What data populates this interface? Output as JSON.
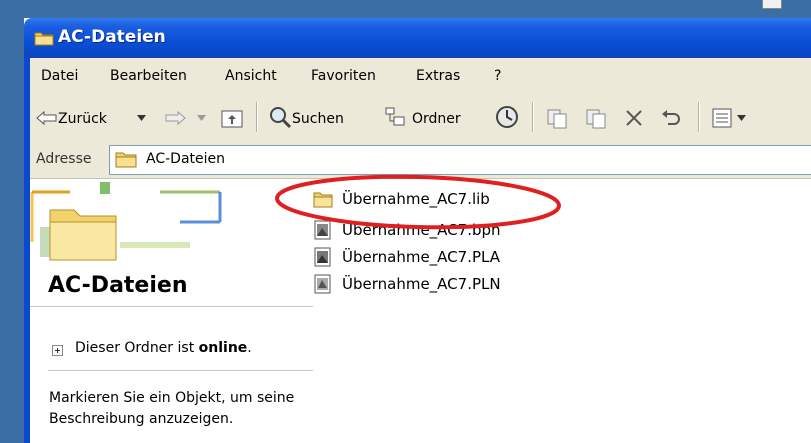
{
  "window": {
    "title": "AC-Dateien"
  },
  "menu": [
    "Datei",
    "Bearbeiten",
    "Ansicht",
    "Favoriten",
    "Extras",
    "?"
  ],
  "toolbar": {
    "back_label": "Zurück",
    "search_label": "Suchen",
    "folders_label": "Ordner"
  },
  "address": {
    "label": "Adresse",
    "value": "AC-Dateien"
  },
  "taskpane": {
    "title": "AC-Dateien",
    "online_prefix": "Dieser Ordner ist ",
    "online_bold": "online",
    "online_suffix": ".",
    "hint": "Markieren Sie ein Objekt, um seine Beschreibung anzuzeigen."
  },
  "files": [
    {
      "name": "Übernahme_AC7.lib",
      "icon": "folder-icon"
    },
    {
      "name": "Übernahme_AC7.bpn",
      "icon": "archicad-bpn-file-icon"
    },
    {
      "name": "Übernahme_AC7.PLA",
      "icon": "archicad-pla-file-icon"
    },
    {
      "name": "Übernahme_AC7.PLN",
      "icon": "archicad-pln-file-icon"
    }
  ],
  "colors": {
    "titlebar": "#0a4fd6",
    "chrome": "#ece9d8",
    "highlight": "#e02020"
  }
}
